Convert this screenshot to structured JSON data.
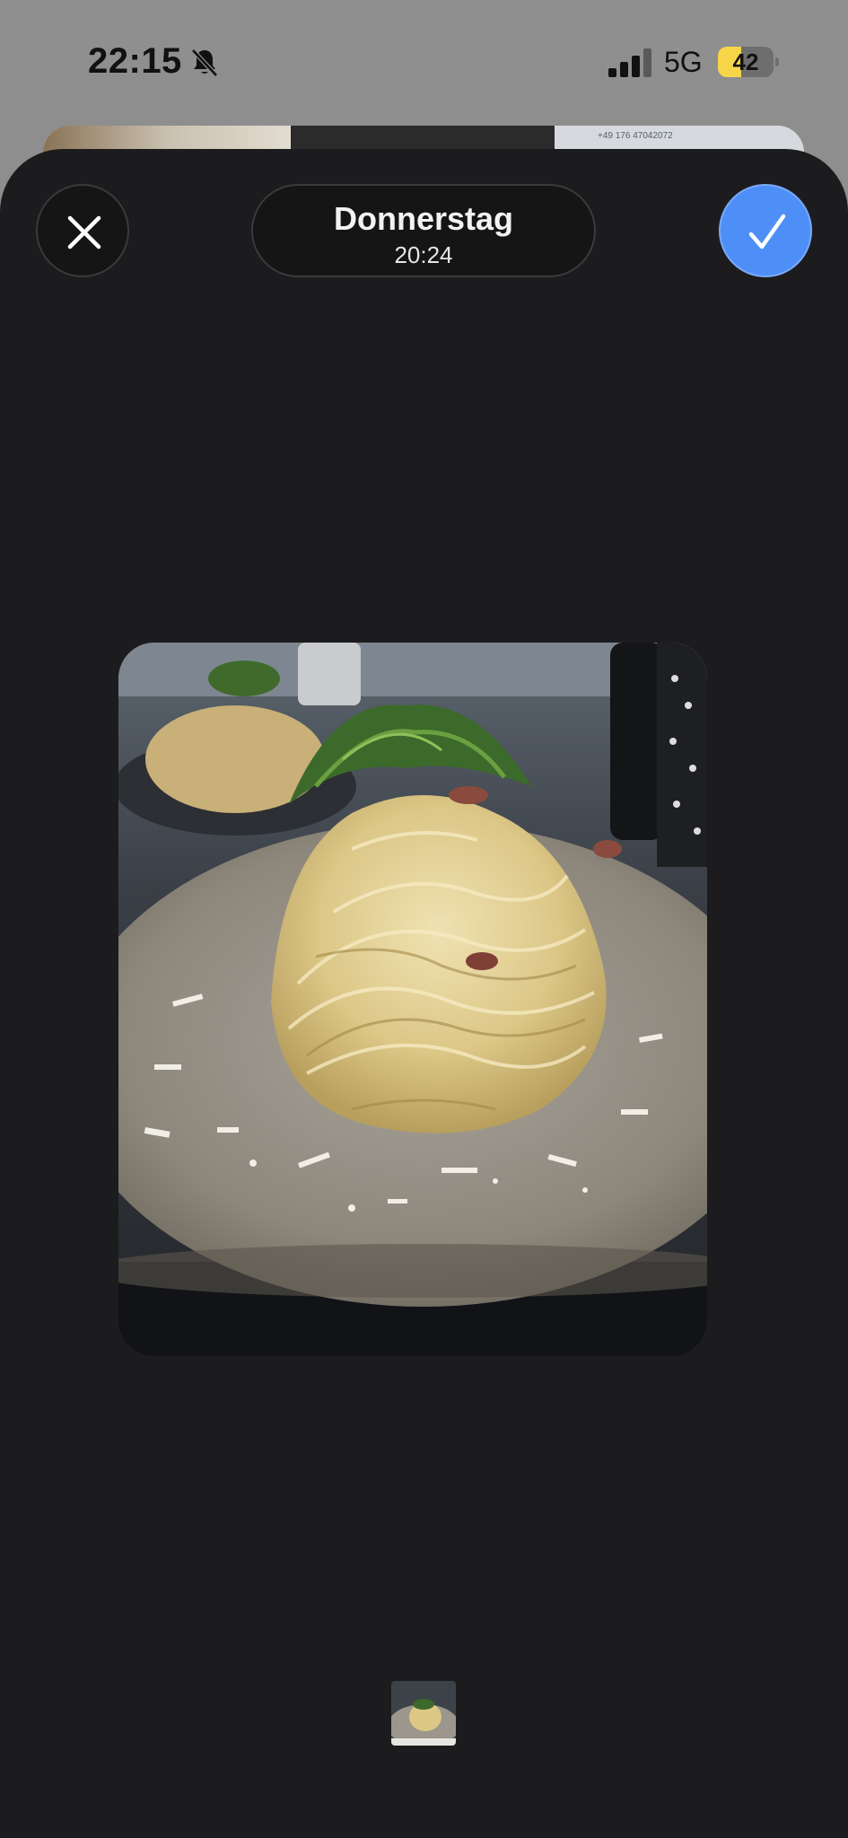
{
  "status_bar": {
    "time": "22:15",
    "silent_icon": "bell-slash-icon",
    "signal_icon": "cellular-signal-icon",
    "network": "5G",
    "battery_level": "42",
    "battery_percent": 42,
    "battery_color": "#f7d548"
  },
  "header": {
    "close_icon": "close-icon",
    "title_day": "Donnerstag",
    "title_time": "20:24",
    "confirm_icon": "checkmark-icon",
    "confirm_color": "#4e8ff7"
  },
  "background_card": {
    "phone_text": "+49 176 47042072"
  },
  "main": {
    "photo_subject": "spaghetti carbonara with arugula and parmesan on a ceramic plate"
  },
  "thumbnail_strip": {
    "count": 1,
    "selected_index": 0
  }
}
